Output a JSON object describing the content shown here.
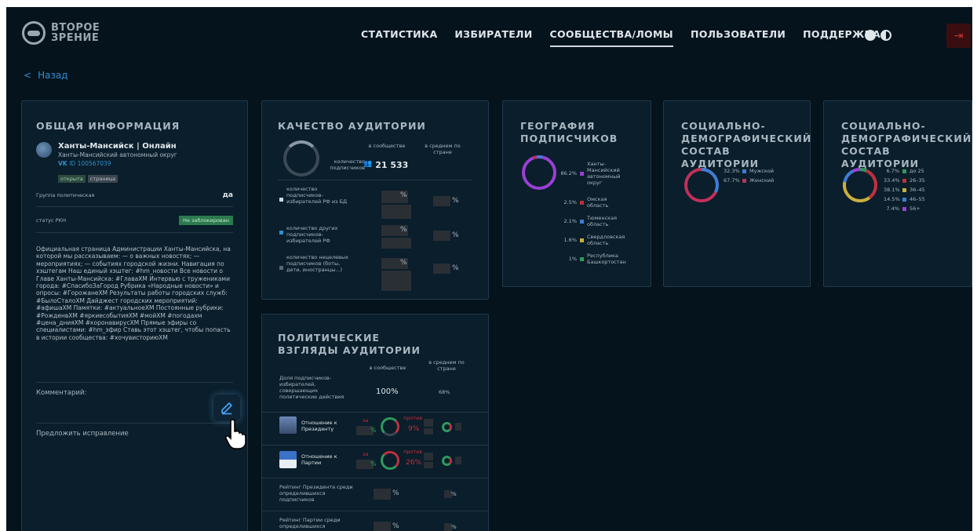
{
  "logo": {
    "line1": "ВТОРОЕ",
    "line2": "ЗРЕНИЕ"
  },
  "nav": [
    {
      "label": "СТАТИСТИКА"
    },
    {
      "label": "ИЗБИРАТЕЛИ"
    },
    {
      "label": "СООБЩЕСТВА/ЛОМЫ"
    },
    {
      "label": "ПОЛЬЗОВАТЕЛИ"
    },
    {
      "label": "ПОДДЕРЖКА"
    }
  ],
  "back": {
    "arrow": "<",
    "label": "Назад"
  },
  "general": {
    "title": "ОБЩАЯ ИНФОРМАЦИЯ",
    "name": "Ханты-Мансийск | Онлайн",
    "region": "Ханты-Мансийский автономный округ",
    "vk_id": "ID 100567039",
    "tag_open": "открыта",
    "tag_page": "страница",
    "political_label": "Группа политическая",
    "political_value": "да",
    "rkn_label": "статус РКН",
    "rkn_value": "Не заблокирован",
    "description": "Официальная страница Администрации Ханты-Мансийска, на которой мы рассказываем: — о важных новостях; — мероприятиях; — событиях городской жизни. Навигация по хэштегам Наш единый хэштег: #hm_новости Все новости о Главе Ханты-Мансийска: #ГлаваХМ Интервью с тружениками города: #СпасибоЗаГород Рубрика «Народные новости» и опросы: #ГорожанеХМ Результаты работы городских служб: #БылоСталоХМ Дайджест городских мероприятий: #афишаХМ Памятки: #актуальноеХМ Постоянные рубрики: #РожденвХМ #яркиесобытияХМ #мойХМ #погодахм #цена_днияХМ #коронавирусХМ Прямые эфиры со специалистами: #hm_эфир Ставь этот хэштег, чтобы попасть в истории сообщества: #хочувисториюХМ",
    "comment_label": "Комментарий:",
    "suggest_label": "Предложить исправление"
  },
  "quality": {
    "title": "КАЧЕСТВО АУДИТОРИИ",
    "col_community": "в сообществе",
    "col_country": "в среднем по стране",
    "subscribers_label": "количество подписчиков",
    "subscribers_value": "21 533",
    "rows": [
      {
        "label": "количество подписчиков-избирателей РФ из БД",
        "color": "#cfd8de"
      },
      {
        "label": "количество других подписчиков-избирателей РФ",
        "color": "#2f8fd0"
      },
      {
        "label": "количество нецелевых подписчиков (боты, дети, иностранцы...)",
        "color": "#5a6670"
      }
    ],
    "percent": "%"
  },
  "geo": {
    "title": "ГЕОГРАФИЯ ПОДПИСЧИКОВ",
    "items": [
      {
        "pct": "86.2%",
        "label": "Ханты-Мансийский автономный округ",
        "color": "#9b3fd4"
      },
      {
        "pct": "2.5%",
        "label": "Омская область",
        "color": "#c0303a"
      },
      {
        "pct": "2.1%",
        "label": "Тюменская область",
        "color": "#3b7fd4"
      },
      {
        "pct": "1.6%",
        "label": "Свердловская область",
        "color": "#c9b03a"
      },
      {
        "pct": "1%",
        "label": "Республика Башкортостан",
        "color": "#2f9a5e"
      }
    ]
  },
  "social1": {
    "title": "СОЦИАЛЬНО-ДЕМОГРАФИЧЕСКИЙ СОСТАВ АУДИТОРИИ",
    "items": [
      {
        "pct": "32.3%",
        "label": "Мужской",
        "color": "#3b7fd4"
      },
      {
        "pct": "67.7%",
        "label": "Женский",
        "color": "#c0305a"
      }
    ]
  },
  "social2": {
    "title": "СОЦИАЛЬНО-ДЕМОГРАФИЧЕСКИЙ СОСТАВ АУДИТОРИИ",
    "items": [
      {
        "pct": "6.7%",
        "label": "до 25",
        "color": "#2f9a5e"
      },
      {
        "pct": "33.4%",
        "label": "26–35",
        "color": "#c0303a"
      },
      {
        "pct": "38.1%",
        "label": "36–45",
        "color": "#c9b03a"
      },
      {
        "pct": "14.5%",
        "label": "46–55",
        "color": "#3b7fd4"
      },
      {
        "pct": "7.4%",
        "label": "56+",
        "color": "#9b3fd4"
      }
    ]
  },
  "politics": {
    "title": "ПОЛИТИЧЕСКИЕ ВЗГЛЯДЫ АУДИТОРИИ",
    "col_community": "в сообществе",
    "col_country": "в среднем по стране",
    "active_label": "Доля подписчиков-избирателей, совершающих политические действия",
    "active_value": "100%",
    "active_country": "68%",
    "president_label": "Отношение к Президенту",
    "party_label": "Отношение к Партии",
    "za": "за",
    "protiv": "против",
    "president_against": "9%",
    "party_against": "26%",
    "rating_president": "Рейтинг Президента среди определившихся подписчиков",
    "rating_party": "Рейтинг Партии среди определившихся",
    "percent": "%"
  }
}
